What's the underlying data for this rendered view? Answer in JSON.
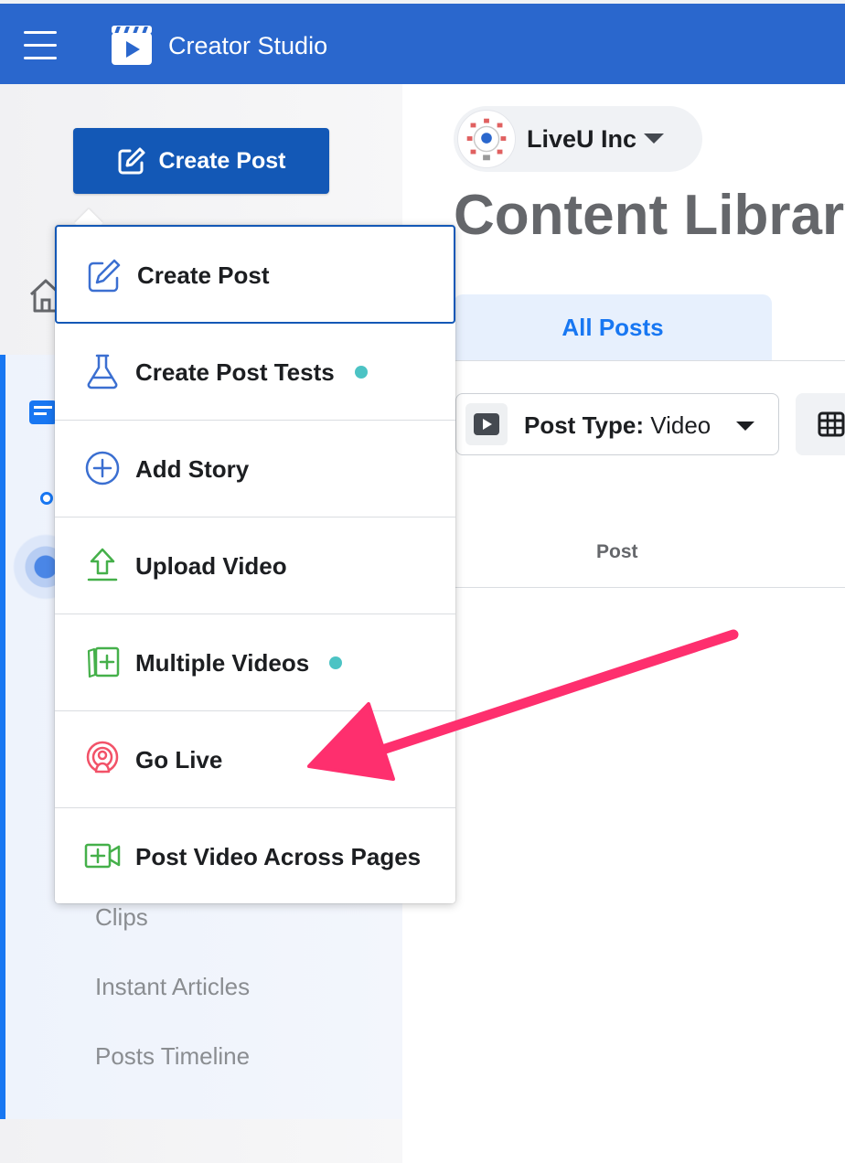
{
  "header": {
    "app_title": "Creator Studio",
    "menu_icon": "hamburger-menu-icon",
    "logo_icon": "clapperboard-play-icon",
    "background_color": "#2a67cd"
  },
  "sidebar": {
    "create_button_label": "Create Post",
    "create_button_color": "#1358b6",
    "accent_color": "#1877f2",
    "links": [
      {
        "label": "Clips"
      },
      {
        "label": "Instant Articles"
      },
      {
        "label": "Posts Timeline"
      }
    ]
  },
  "page_selector": {
    "name": "LiveU Inc"
  },
  "main": {
    "title": "Content Library",
    "tabs": [
      {
        "label": "All Posts",
        "active": true
      }
    ],
    "filter": {
      "key_label": "Post Type:",
      "value_label": "Video"
    },
    "table_header": {
      "post_column": "Post"
    }
  },
  "dropdown": {
    "items": [
      {
        "label": "Create Post",
        "icon": "pencil-square-icon",
        "icon_color": "#3b6fd1",
        "new": false,
        "focused": true
      },
      {
        "label": "Create Post Tests",
        "icon": "beaker-icon",
        "icon_color": "#3b6fd1",
        "new": true
      },
      {
        "label": "Add Story",
        "icon": "plus-circle-icon",
        "icon_color": "#3b6fd1",
        "new": false
      },
      {
        "label": "Upload Video",
        "icon": "upload-arrow-icon",
        "icon_color": "#45b04a",
        "new": false
      },
      {
        "label": "Multiple Videos",
        "icon": "multiple-videos-icon",
        "icon_color": "#45b04a",
        "new": true
      },
      {
        "label": "Go Live",
        "icon": "live-broadcast-icon",
        "icon_color": "#f25268",
        "new": false
      },
      {
        "label": "Post Video Across Pages",
        "icon": "video-camera-plus-icon",
        "icon_color": "#45b04a",
        "new": false
      }
    ],
    "new_dot_color": "#4cc3c4"
  },
  "annotation": {
    "arrow_color": "#fe2f6e"
  }
}
